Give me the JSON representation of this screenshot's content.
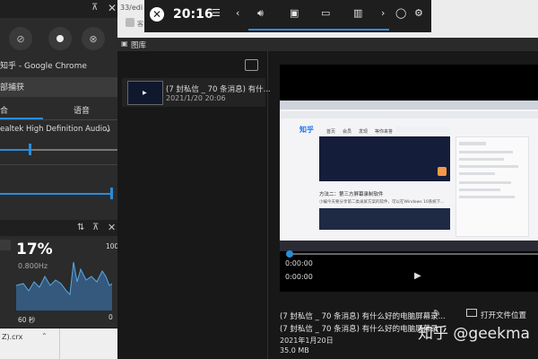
{
  "background_browser": {
    "url_fragment": "33/edi",
    "tab_fragment": "客"
  },
  "left_panel": {
    "app_name": "知乎 - Google Chrome",
    "capture_label": "部捕获",
    "tab_mix": "合",
    "tab_voice": "语音",
    "device": "ealtek High Definition Audio)"
  },
  "perf": {
    "cpu_percent": "17%",
    "frequency": "0.800Hz",
    "graph_max": "100",
    "graph_min": "0",
    "time_window": "60 秒"
  },
  "file_bar": {
    "ext": "Z).crx"
  },
  "gamebar": {
    "clock": "20:16"
  },
  "gallery": {
    "title": "图库",
    "item_title": "(7 封私信 _ 70 条消息) 有什...",
    "item_date": "2021/1/20 20:06"
  },
  "player": {
    "time_current": "0:00:00",
    "time_total": "0:00:00",
    "progress": 0
  },
  "details": {
    "title": "(7 封私信 _ 70 条消息) 有什么好的电脑屏幕录...",
    "title_line2": "(7 封私信 _ 70 条消息) 有什么好的电脑屏幕录",
    "date": "2021年1月20日",
    "size": "35.0 MB",
    "open_location": "打开文件位置"
  },
  "watermark": "知乎 @geekma",
  "video_content": {
    "site_logo": "知乎",
    "nav_items": [
      "首页",
      "会员",
      "发现",
      "等你来答"
    ],
    "heading": "方法二：第三方屏幕录制软件",
    "body_text": "小编今天要分享第二类录屏方案的软件，可以在Windows 10系统下..."
  },
  "colors": {
    "accent": "#2b8cd8",
    "panel": "#2b2b2b",
    "gallery_bg": "#181818"
  }
}
